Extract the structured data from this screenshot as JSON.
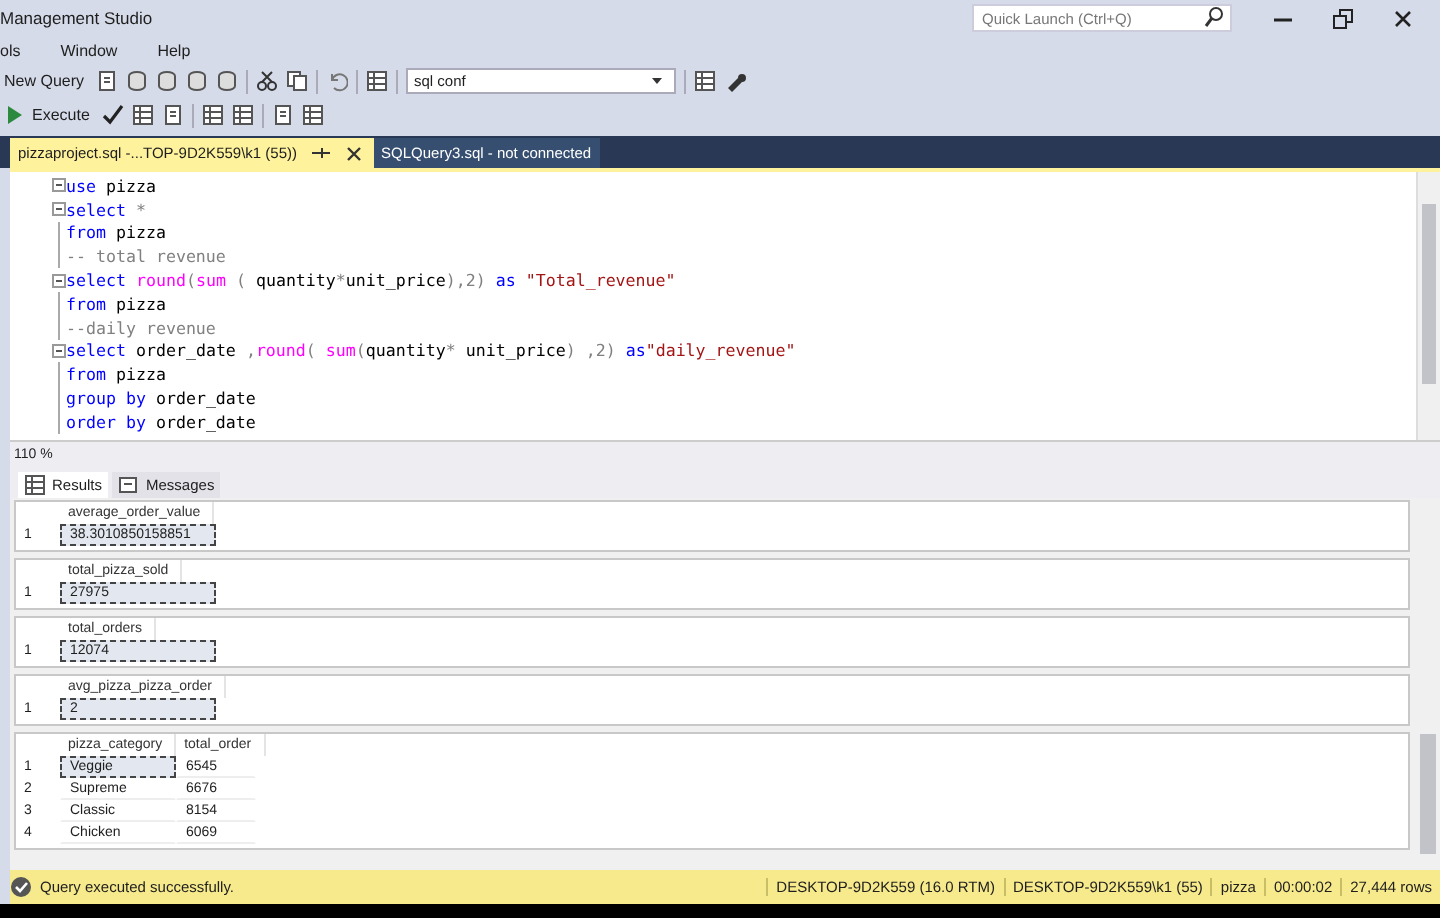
{
  "window": {
    "title": "Management Studio",
    "quick_launch": {
      "placeholder": "Quick Launch (Ctrl+Q)"
    }
  },
  "menu": [
    "ols",
    "Window",
    "Help"
  ],
  "toolbar": {
    "new_query": "New Query",
    "execute": "Execute",
    "database": "sql conf"
  },
  "doc_tabs": [
    {
      "label": "pizzaproject.sql -...TOP-9D2K559\\k1 (55))",
      "selected": true
    },
    {
      "label": "SQLQuery3.sql - not connected",
      "selected": false
    }
  ],
  "editor": {
    "lines": [
      {
        "fold": true,
        "tokens": [
          {
            "kind": "keyword",
            "text": "use"
          },
          {
            "kind": "plain",
            "text": " pizza"
          }
        ]
      },
      {
        "fold": true,
        "tokens": [
          {
            "kind": "keyword",
            "text": "select"
          },
          {
            "kind": "op",
            "text": " *"
          }
        ]
      },
      {
        "fold": false,
        "tokens": [
          {
            "kind": "keyword",
            "text": "from"
          },
          {
            "kind": "plain",
            "text": " pizza"
          }
        ]
      },
      {
        "fold": false,
        "tokens": [
          {
            "kind": "comment",
            "text": "-- total revenue"
          }
        ]
      },
      {
        "fold": true,
        "tokens": [
          {
            "kind": "keyword",
            "text": "select "
          },
          {
            "kind": "func",
            "text": "round"
          },
          {
            "kind": "op",
            "text": "("
          },
          {
            "kind": "func",
            "text": "sum"
          },
          {
            "kind": "op",
            "text": " ( "
          },
          {
            "kind": "plain",
            "text": "quantity"
          },
          {
            "kind": "op",
            "text": "*"
          },
          {
            "kind": "plain",
            "text": "unit_price"
          },
          {
            "kind": "op",
            "text": "),2) "
          },
          {
            "kind": "keyword",
            "text": "as"
          },
          {
            "kind": "string",
            "text": " \"Total_revenue\""
          }
        ]
      },
      {
        "fold": false,
        "tokens": [
          {
            "kind": "keyword",
            "text": "from"
          },
          {
            "kind": "plain",
            "text": " pizza"
          }
        ]
      },
      {
        "fold": false,
        "tokens": [
          {
            "kind": "comment",
            "text": "--daily revenue"
          }
        ]
      },
      {
        "fold": true,
        "tokens": [
          {
            "kind": "keyword",
            "text": "select"
          },
          {
            "kind": "plain",
            "text": " order_date "
          },
          {
            "kind": "op",
            "text": ","
          },
          {
            "kind": "func",
            "text": "round"
          },
          {
            "kind": "op",
            "text": "( "
          },
          {
            "kind": "func",
            "text": "sum"
          },
          {
            "kind": "op",
            "text": "("
          },
          {
            "kind": "plain",
            "text": "quantity"
          },
          {
            "kind": "op",
            "text": "* "
          },
          {
            "kind": "plain",
            "text": "unit_price"
          },
          {
            "kind": "op",
            "text": ") ,2) "
          },
          {
            "kind": "keyword",
            "text": "as"
          },
          {
            "kind": "string",
            "text": "\"daily_revenue\""
          }
        ]
      },
      {
        "fold": false,
        "tokens": [
          {
            "kind": "keyword",
            "text": "from"
          },
          {
            "kind": "plain",
            "text": " pizza"
          }
        ]
      },
      {
        "fold": false,
        "tokens": [
          {
            "kind": "keyword",
            "text": "group by"
          },
          {
            "kind": "plain",
            "text": " order_date"
          }
        ]
      },
      {
        "fold": false,
        "tokens": [
          {
            "kind": "keyword",
            "text": "order by"
          },
          {
            "kind": "plain",
            "text": " order_date"
          }
        ]
      }
    ],
    "zoom": "110 %"
  },
  "result_tabs": [
    {
      "label": "Results",
      "selected": true
    },
    {
      "label": "Messages",
      "selected": false
    }
  ],
  "result_sets": [
    {
      "columns": [
        "",
        "average_order_value"
      ],
      "rows": [
        [
          "1",
          "38.3010850158851"
        ]
      ]
    },
    {
      "columns": [
        "",
        "total_pizza_sold"
      ],
      "rows": [
        [
          "1",
          "27975"
        ]
      ]
    },
    {
      "columns": [
        "",
        "total_orders"
      ],
      "rows": [
        [
          "1",
          "12074"
        ]
      ]
    },
    {
      "columns": [
        "",
        "avg_pizza_pizza_order"
      ],
      "rows": [
        [
          "1",
          "2"
        ]
      ]
    },
    {
      "columns": [
        "",
        "pizza_category",
        "total_order"
      ],
      "rows": [
        [
          "1",
          "Veggie",
          "6545"
        ],
        [
          "2",
          "Supreme",
          "6676"
        ],
        [
          "3",
          "Classic",
          "8154"
        ],
        [
          "4",
          "Chicken",
          "6069"
        ]
      ]
    }
  ],
  "status_bar": {
    "message": "Query executed successfully.",
    "segments": [
      "DESKTOP-9D2K559 (16.0 RTM)",
      "DESKTOP-9D2K559\\k1 (55)",
      "pizza",
      "00:00:02",
      "27,444 rows"
    ]
  }
}
